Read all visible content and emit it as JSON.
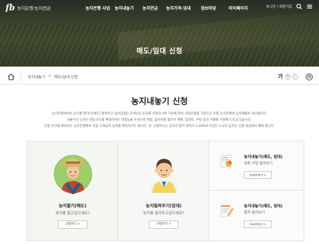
{
  "header": {
    "logo_mark": "fb",
    "logo_text": "농지은행·농지연금",
    "nav": [
      "농지은행 사업",
      "농지내놓기",
      "농지연금",
      "농지가격·임대",
      "정보마당",
      "마이페이지"
    ],
    "util_links": "로그인 / 회원가입",
    "page_title": "매도/임대 신청"
  },
  "breadcrumb": {
    "items": [
      "농지내놓기",
      ">",
      "매도/임대 신청"
    ],
    "font_label": "가",
    "font_minus": "-",
    "font_plus": "+"
  },
  "main": {
    "title": "농지내놓기 신청",
    "description": [
      "농지은행에서는 농지를 팔거나(매도) 빌려주고 싶은(임대) 고객님의 농지를 신청하시면 기준에 따라 사업유형을 구분하고 이를 농지은행에 농지매물로 게시합니다.",
      "내놓으신 농지는 영농규모를 확대하려는 전업농을 우선으로 매입, 임차자를 찾아서 매매, 임대차, 수탁 등의 거래를 지원해 드리고 있습니다.",
      "신청 조건에 따라서는 농지은행에서 직접 고객님의 농지를 매입하기도 합니다. 단, 신청하시는 농지의 필지 면적이 1,000㎡ 이상인 소규모 농지는 신청 대상에서 제외 합니다."
    ]
  },
  "cards": [
    {
      "title": "농지팔기(매도)",
      "subtitle": "농지를 팔고싶으세요?",
      "button": "신청하기 >",
      "icon": "farmer-woman-avatar"
    },
    {
      "title": "농지빌려주기(임대)",
      "subtitle": "농지를 빌려주고싶으세요?",
      "button": "신청하기 >",
      "icon": "farmer-man-avatar"
    }
  ],
  "side_cards": [
    {
      "title": "농지내놓기(매도, 임대)",
      "subtitle": "관련 사업 알아보기",
      "button": "자세히보기 >",
      "icon": "document-chart-icon"
    },
    {
      "title": "농지내놓기(매도, 임대)",
      "subtitle": "절차 알아보기",
      "button": "자세히보기 >",
      "icon": "notepad-pencil-icon"
    }
  ],
  "colors": {
    "accent_green": "#5a9a3a",
    "title_text": "#222222",
    "card_bg": "#f4f6f1"
  }
}
